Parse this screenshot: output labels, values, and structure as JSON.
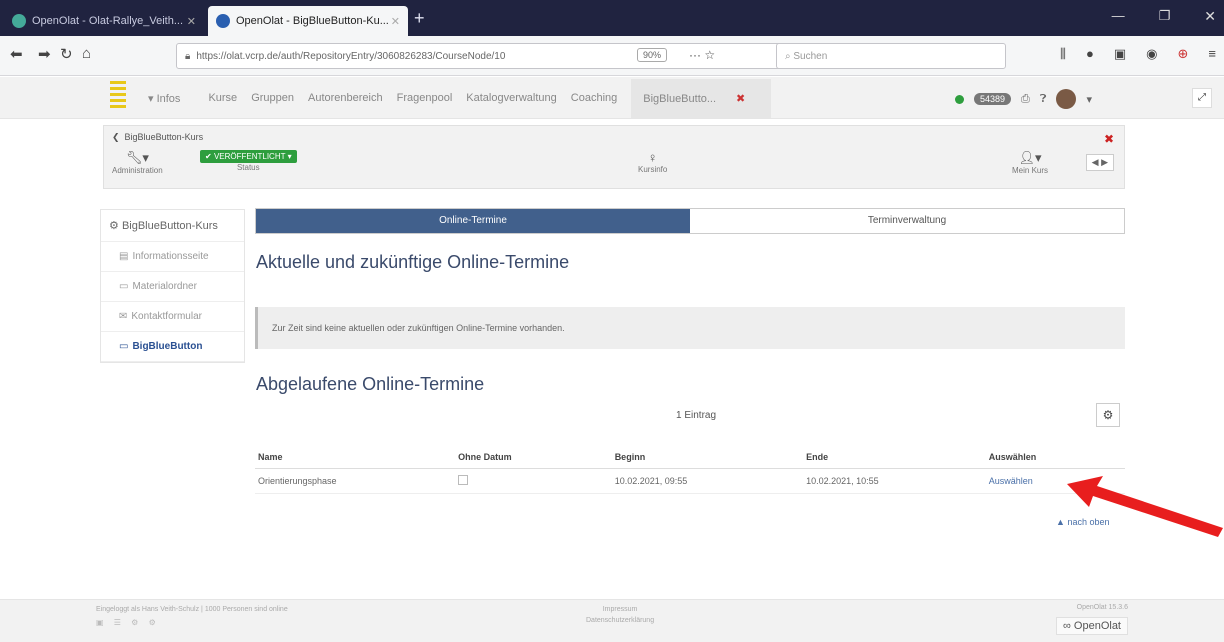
{
  "browser": {
    "tabs": [
      {
        "label": "OpenOlat - Olat-Rallye_Veith..."
      },
      {
        "label": "OpenOlat - BigBlueButton-Ku..."
      }
    ],
    "url": "https://olat.vcrp.de/auth/RepositoryEntry/3060826283/CourseNode/10",
    "zoom": "90%",
    "search_placeholder": "Suchen"
  },
  "app": {
    "nav": [
      "Infos",
      "Kurse",
      "Gruppen",
      "Autorenbereich",
      "Fragenpool",
      "Katalogverwaltung",
      "Coaching"
    ],
    "active_tab": "BigBlueButto...",
    "notification_count": "54389"
  },
  "course_toolbar": {
    "back_label": "BigBlueButton-Kurs",
    "admin_label": "Administration",
    "status_value": "VERÖFFENTLICHT",
    "status_label": "Status",
    "kursinfo_label": "Kursinfo",
    "meinkurs_label": "Mein Kurs"
  },
  "sidebar": {
    "root": "BigBlueButton-Kurs",
    "items": [
      {
        "label": "Informationsseite",
        "active": false
      },
      {
        "label": "Materialordner",
        "active": false
      },
      {
        "label": "Kontaktformular",
        "active": false
      },
      {
        "label": "BigBlueButton",
        "active": true
      }
    ]
  },
  "main": {
    "tabs": [
      "Online-Termine",
      "Terminverwaltung"
    ],
    "current_heading": "Aktuelle und zukünftige Online-Termine",
    "no_meetings_text": "Zur Zeit sind keine aktuellen oder zukünftigen Online-Termine vorhanden.",
    "past_heading": "Abgelaufene Online-Termine",
    "entry_count": "1 Eintrag",
    "table": {
      "headers": [
        "Name",
        "Ohne Datum",
        "Beginn",
        "Ende",
        "Auswählen"
      ],
      "rows": [
        {
          "name": "Orientierungsphase",
          "begin": "10.02.2021, 09:55",
          "end": "10.02.2021, 10:55",
          "select": "Auswählen"
        }
      ]
    },
    "back_to_top": "nach oben"
  },
  "footer": {
    "left": "Eingeloggt als Hans Veith-Schulz  | 1000 Personen sind online",
    "center_1": "Impressum",
    "center_2": "Datenschutzerklärung",
    "version": "OpenOlat 15.3.6",
    "brand": "OpenOlat"
  },
  "colors": {
    "accent": "#41608c",
    "status_green": "#2e9e3e",
    "arrow": "#e81e1e"
  }
}
